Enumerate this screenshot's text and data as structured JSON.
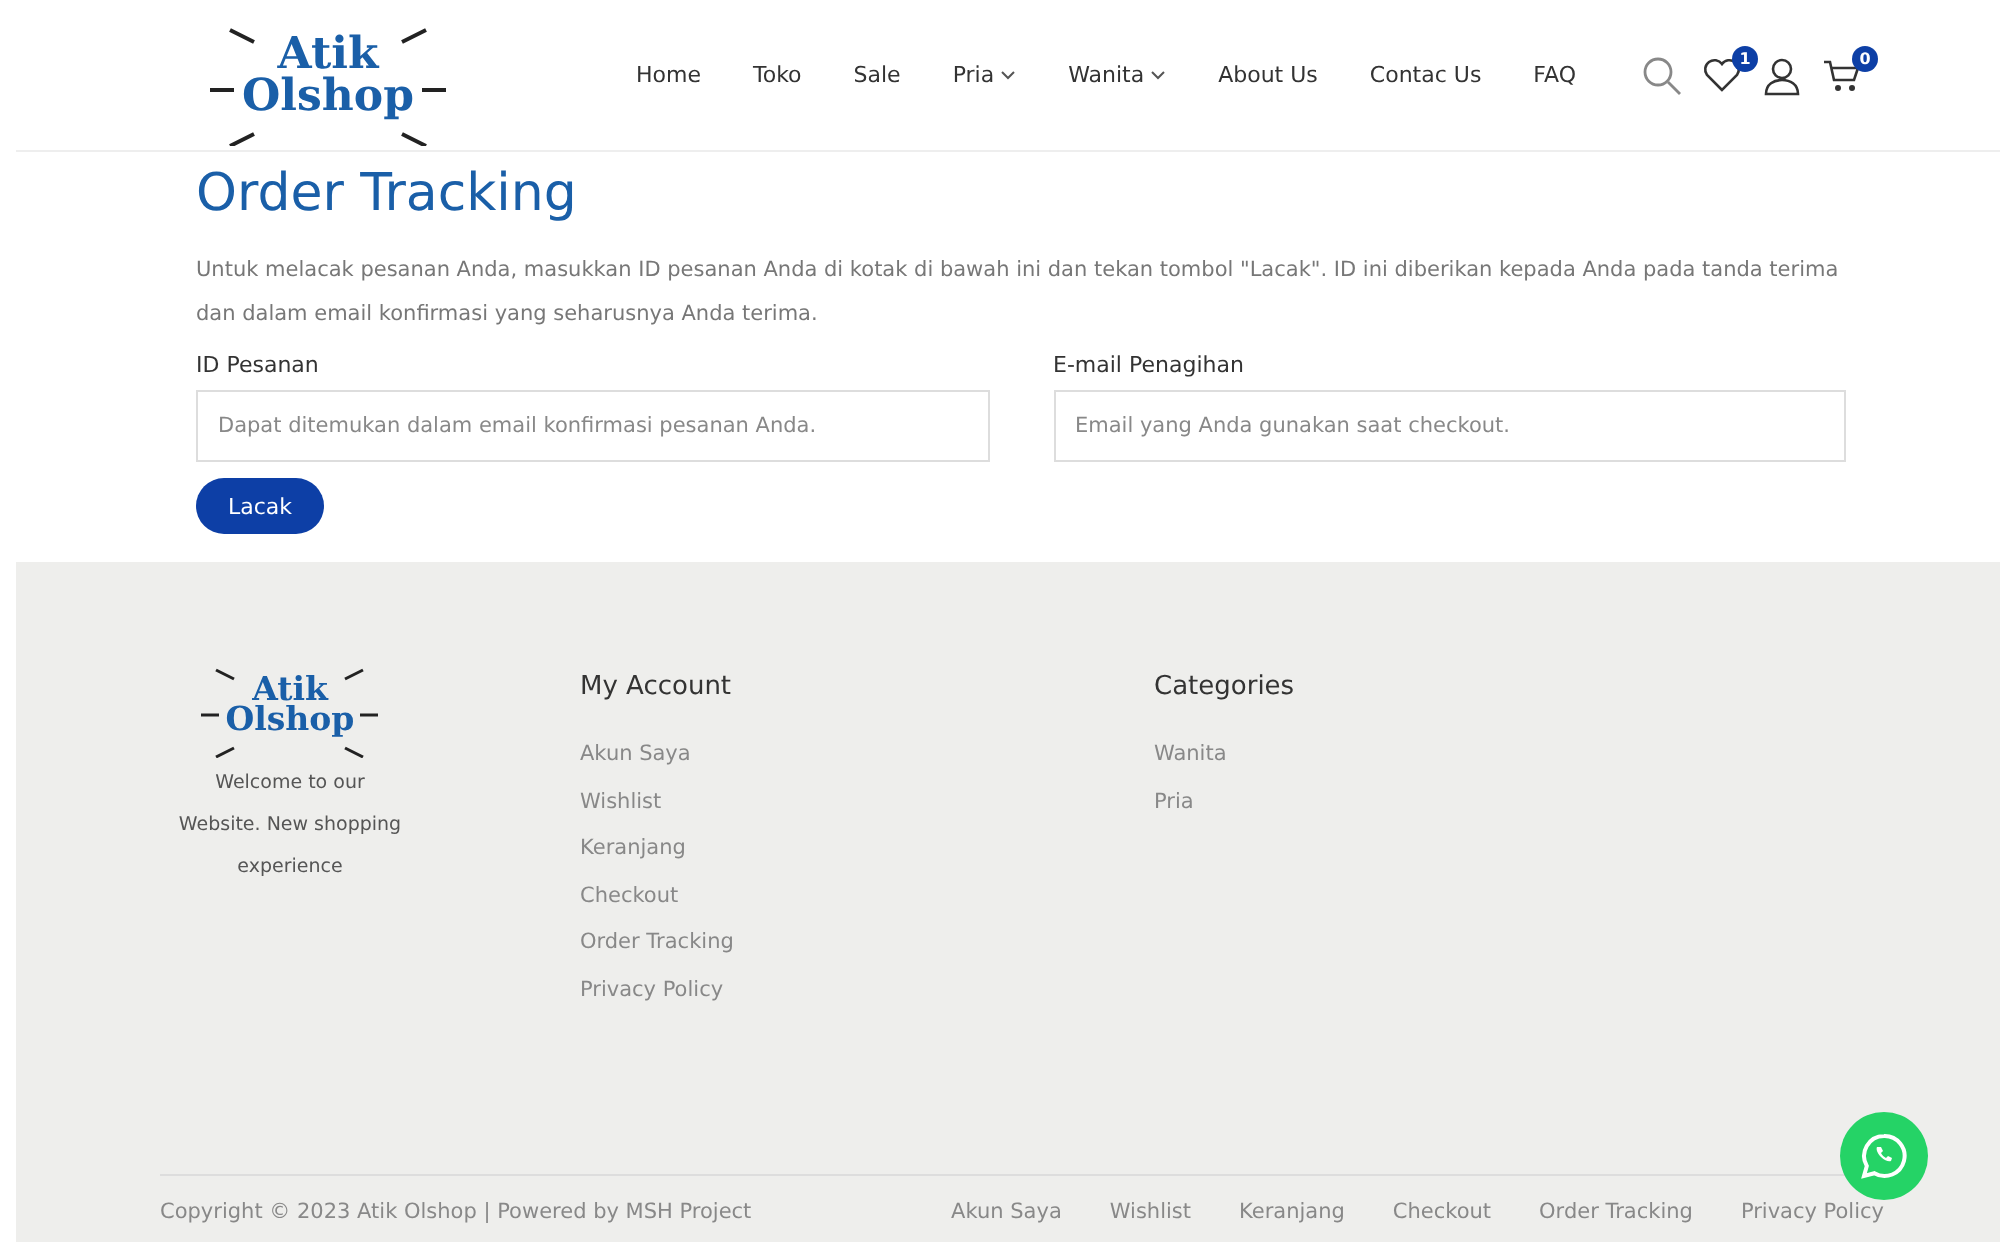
{
  "header": {
    "logo": {
      "line1": "Atik",
      "line2": "Olshop"
    },
    "nav": [
      {
        "label": "Home",
        "dropdown": false
      },
      {
        "label": "Toko",
        "dropdown": false
      },
      {
        "label": "Sale",
        "dropdown": false
      },
      {
        "label": "Pria",
        "dropdown": true
      },
      {
        "label": "Wanita",
        "dropdown": true
      },
      {
        "label": "About Us",
        "dropdown": false
      },
      {
        "label": "Contac Us",
        "dropdown": false
      },
      {
        "label": "FAQ",
        "dropdown": false
      }
    ],
    "wishlist_count": "1",
    "cart_count": "0"
  },
  "main": {
    "title": "Order Tracking",
    "intro": "Untuk melacak pesanan Anda, masukkan ID pesanan Anda di kotak di bawah ini dan tekan tombol \"Lacak\". ID ini diberikan kepada Anda pada tanda terima dan dalam email konfirmasi yang seharusnya Anda terima.",
    "fields": [
      {
        "label": "ID Pesanan",
        "placeholder": "Dapat ditemukan dalam email konfirmasi pesanan Anda."
      },
      {
        "label": "E-mail Penagihan",
        "placeholder": "Email yang Anda gunakan saat checkout."
      }
    ],
    "button": "Lacak"
  },
  "footer": {
    "logo": {
      "line1": "Atik",
      "line2": "Olshop"
    },
    "tagline": "Welcome to our Website. New shopping experience",
    "columns": [
      {
        "title": "My Account",
        "links": [
          "Akun Saya",
          "Wishlist",
          "Keranjang",
          "Checkout",
          "Order Tracking",
          "Privacy Policy"
        ]
      },
      {
        "title": "Categories",
        "links": [
          "Wanita",
          "Pria"
        ]
      }
    ],
    "copyright": "Copyright © 2023 Atik Olshop | Powered by MSH Project",
    "bottom_links": [
      "Akun Saya",
      "Wishlist",
      "Keranjang",
      "Checkout",
      "Order Tracking",
      "Privacy Policy"
    ]
  }
}
